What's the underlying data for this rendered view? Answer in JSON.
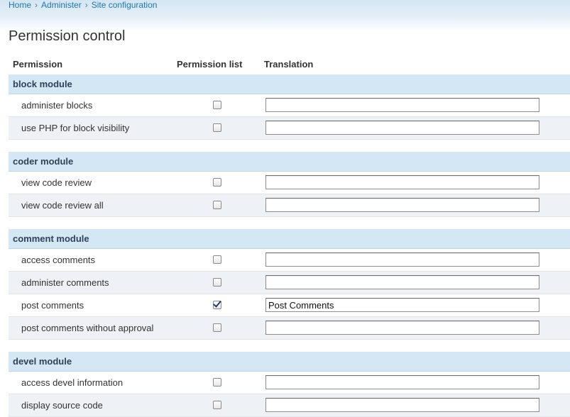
{
  "breadcrumb": [
    "Home",
    "Administer",
    "Site configuration"
  ],
  "page_title": "Permission control",
  "columns": {
    "permission": "Permission",
    "permission_list": "Permission list",
    "translation": "Translation"
  },
  "modules": [
    {
      "name": "block module",
      "permissions": [
        {
          "label": "administer blocks",
          "checked": false,
          "translation": ""
        },
        {
          "label": "use PHP for block visibility",
          "checked": false,
          "translation": ""
        }
      ]
    },
    {
      "name": "coder module",
      "permissions": [
        {
          "label": "view code review",
          "checked": false,
          "translation": ""
        },
        {
          "label": "view code review all",
          "checked": false,
          "translation": ""
        }
      ]
    },
    {
      "name": "comment module",
      "permissions": [
        {
          "label": "access comments",
          "checked": false,
          "translation": ""
        },
        {
          "label": "administer comments",
          "checked": false,
          "translation": ""
        },
        {
          "label": "post comments",
          "checked": true,
          "translation": "Post Comments"
        },
        {
          "label": "post comments without approval",
          "checked": false,
          "translation": ""
        }
      ]
    },
    {
      "name": "devel module",
      "permissions": [
        {
          "label": "access devel information",
          "checked": false,
          "translation": ""
        },
        {
          "label": "display source code",
          "checked": false,
          "translation": ""
        }
      ]
    }
  ]
}
